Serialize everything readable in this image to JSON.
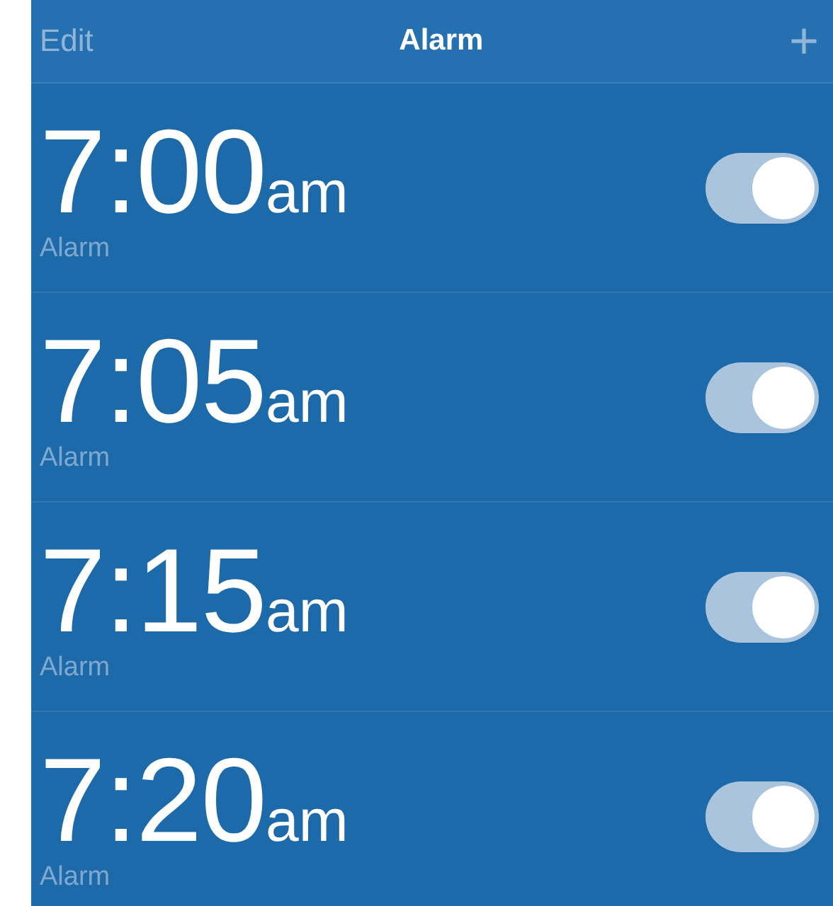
{
  "header": {
    "left": "Edit",
    "title": "Alarm",
    "right": "+"
  },
  "alarms": [
    {
      "time": "7:00",
      "period": "am",
      "label": "Alarm",
      "on": true
    },
    {
      "time": "7:05",
      "period": "am",
      "label": "Alarm",
      "on": true
    },
    {
      "time": "7:15",
      "period": "am",
      "label": "Alarm",
      "on": true
    },
    {
      "time": "7:20",
      "period": "am",
      "label": "Alarm",
      "on": true
    }
  ]
}
